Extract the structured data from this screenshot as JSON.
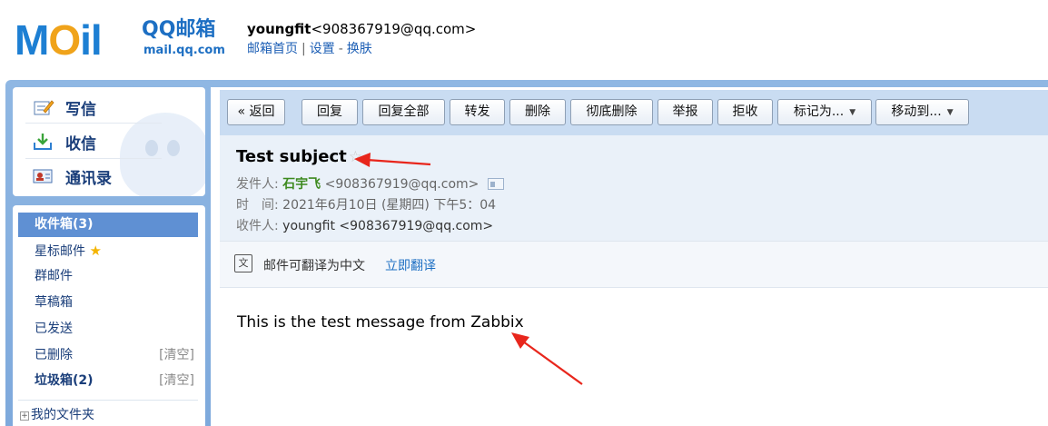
{
  "header": {
    "logo_brand": "MOil",
    "logo_cn": "QQ邮箱",
    "logo_url": "mail.qq.com",
    "user_name": "youngfit",
    "user_email": "<908367919@qq.com>",
    "links": [
      "邮箱首页",
      "设置",
      "换肤"
    ]
  },
  "quick_actions": [
    "写信",
    "收信",
    "通讯录"
  ],
  "folders": {
    "inbox": "收件箱(3)",
    "starred": "星标邮件",
    "group": "群邮件",
    "drafts": "草稿箱",
    "sent": "已发送",
    "deleted": "已删除",
    "spam": "垃圾箱(2)",
    "clear_label": "[清空]",
    "my_folders": "我的文件夹"
  },
  "toolbar": {
    "back": "« 返回",
    "reply": "回复",
    "reply_all": "回复全部",
    "forward": "转发",
    "delete": "删除",
    "delete_permanent": "彻底删除",
    "report": "举报",
    "reject": "拒收",
    "mark_as": "标记为...",
    "move_to": "移动到..."
  },
  "message": {
    "subject": "Test subject",
    "from_label": "发件人:",
    "from_name": "石宇飞",
    "from_email": "<908367919@qq.com>",
    "time_label": "时　间:",
    "time_value": "2021年6月10日 (星期四) 下午5：04",
    "to_label": "收件人:",
    "to_value": "youngfit <908367919@qq.com>",
    "translate_text": "邮件可翻译为中文",
    "translate_action": "立即翻译",
    "body": "This is the test message from Zabbix"
  },
  "colors": {
    "arrow": "#e8261c",
    "accent": "#5f90d3",
    "frame": "#8fb7e3"
  }
}
